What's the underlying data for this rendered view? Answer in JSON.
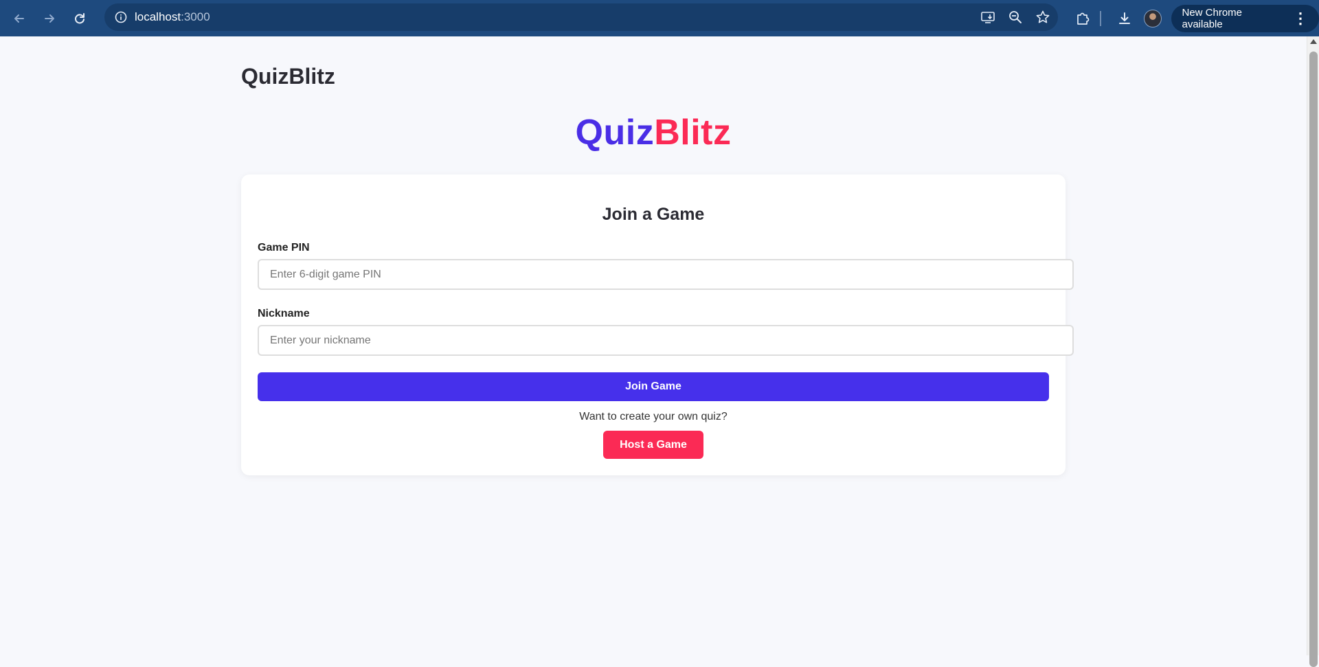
{
  "browser": {
    "url_host": "localhost",
    "url_port": ":3000",
    "update_label": "New Chrome available",
    "icons": {
      "back": "arrow-left-icon",
      "forward": "arrow-right-icon",
      "reload": "reload-icon",
      "site_info": "info-icon",
      "install": "install-app-icon",
      "zoom": "zoom-out-icon",
      "bookmark": "star-icon",
      "extensions": "puzzle-icon",
      "downloads": "download-icon",
      "menu": "kebab-icon"
    }
  },
  "header": {
    "site_title": "QuizBlitz"
  },
  "logo": {
    "part1": "Quiz",
    "part2": "Blitz",
    "colors": {
      "part1": "#4a2ee6",
      "part2": "#fb2a55"
    }
  },
  "join_card": {
    "title": "Join a Game",
    "pin_label": "Game PIN",
    "pin_placeholder": "Enter 6-digit game PIN",
    "pin_value": "",
    "nickname_label": "Nickname",
    "nickname_placeholder": "Enter your nickname",
    "nickname_value": "",
    "join_button": "Join Game",
    "host_prompt": "Want to create your own quiz?",
    "host_button": "Host a Game",
    "colors": {
      "primary": "#4630eb",
      "secondary": "#fb2a55"
    }
  }
}
